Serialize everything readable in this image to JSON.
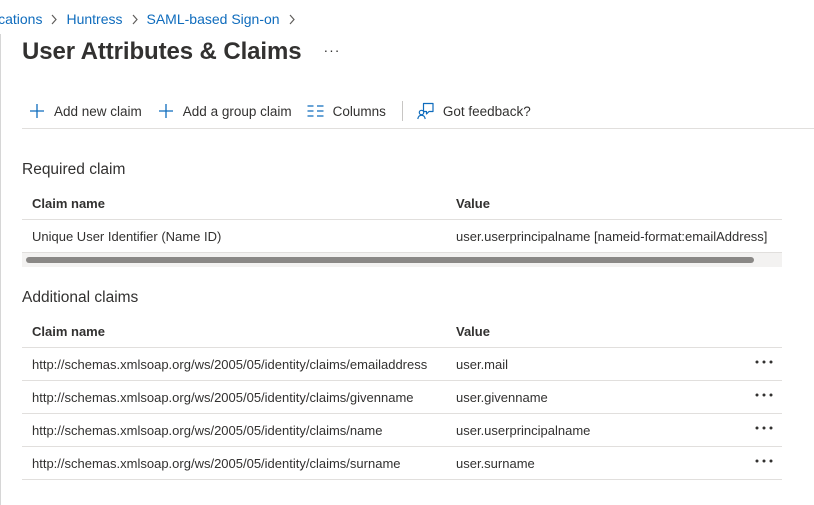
{
  "breadcrumb": {
    "items": [
      "ications",
      "Huntress",
      "SAML-based Sign-on"
    ]
  },
  "header": {
    "title": "User Attributes & Claims",
    "more": "···"
  },
  "toolbar": {
    "add_claim": "Add new claim",
    "add_group_claim": "Add a group claim",
    "columns": "Columns",
    "feedback": "Got feedback?"
  },
  "required": {
    "title": "Required claim",
    "columns": {
      "name": "Claim name",
      "value": "Value"
    },
    "rows": [
      {
        "name": "Unique User Identifier (Name ID)",
        "value": "user.userprincipalname [nameid-format:emailAddress]"
      }
    ]
  },
  "additional": {
    "title": "Additional claims",
    "columns": {
      "name": "Claim name",
      "value": "Value"
    },
    "rows": [
      {
        "name": "http://schemas.xmlsoap.org/ws/2005/05/identity/claims/emailaddress",
        "value": "user.mail"
      },
      {
        "name": "http://schemas.xmlsoap.org/ws/2005/05/identity/claims/givenname",
        "value": "user.givenname"
      },
      {
        "name": "http://schemas.xmlsoap.org/ws/2005/05/identity/claims/name",
        "value": "user.userprincipalname"
      },
      {
        "name": "http://schemas.xmlsoap.org/ws/2005/05/identity/claims/surname",
        "value": "user.surname"
      }
    ]
  },
  "icons": {
    "add": "plus-icon",
    "columns": "columns-icon",
    "feedback": "feedback-icon",
    "more": "more-icon",
    "separator": "chevron-right-icon"
  },
  "colors": {
    "link": "#0f6cbd",
    "accent": "#0f6cbd",
    "text": "#323130",
    "border": "#e1dfdd"
  }
}
